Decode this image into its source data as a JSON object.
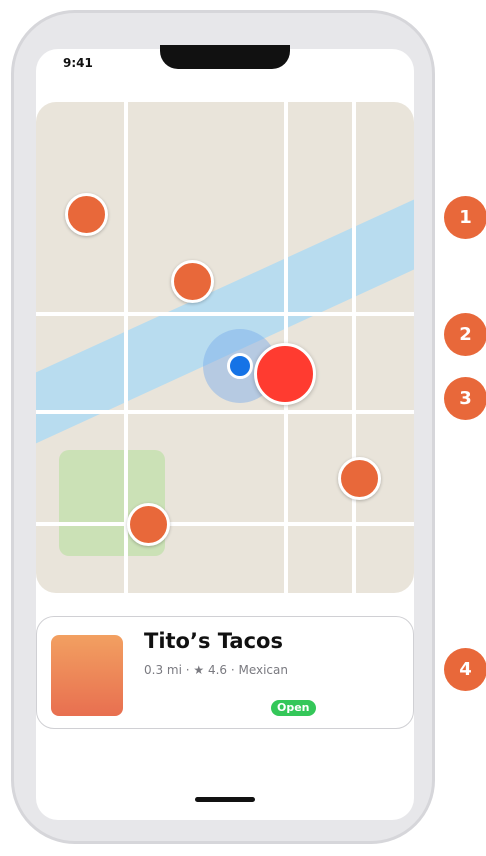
{
  "status_bar": {
    "time": "9:41"
  },
  "map": {
    "colors": {
      "land": "#e9e4da",
      "road": "#ffffff",
      "water": "#b8dcef",
      "park": "#cbe1b6",
      "restaurant_pin": "#e8683a",
      "selected_pin": "#ff3b30",
      "user_location": "#1573e6"
    },
    "pins": [
      "restaurant-pin",
      "restaurant-pin",
      "restaurant-pin",
      "restaurant-pin"
    ],
    "selected_pin": "selected-restaurant-pin"
  },
  "place_card": {
    "name": "Tito’s Tacos",
    "details": "0.3 mi · ★ 4.6 · Mexican",
    "status_badge": "Open"
  },
  "callouts": [
    "1",
    "2",
    "3",
    "4"
  ]
}
